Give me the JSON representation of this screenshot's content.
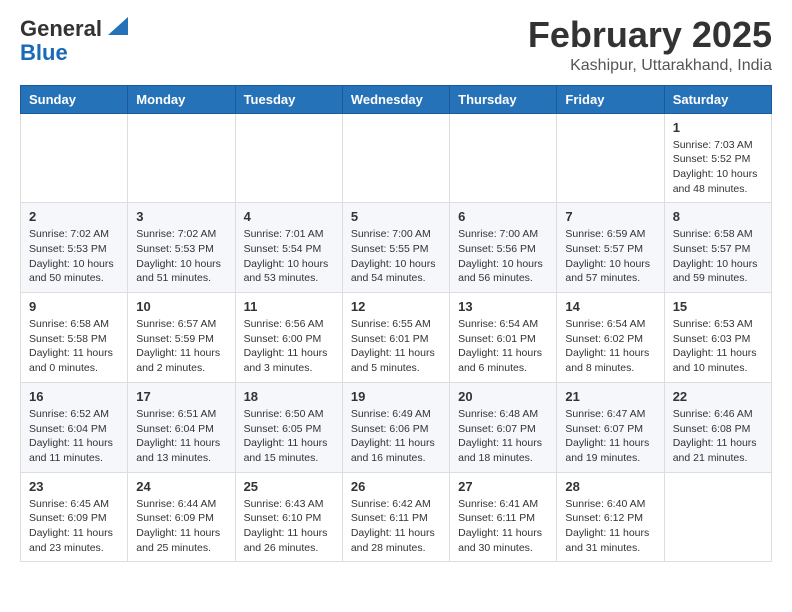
{
  "logo": {
    "general": "General",
    "blue": "Blue"
  },
  "header": {
    "month": "February 2025",
    "location": "Kashipur, Uttarakhand, India"
  },
  "days_of_week": [
    "Sunday",
    "Monday",
    "Tuesday",
    "Wednesday",
    "Thursday",
    "Friday",
    "Saturday"
  ],
  "weeks": [
    [
      {
        "day": "",
        "info": ""
      },
      {
        "day": "",
        "info": ""
      },
      {
        "day": "",
        "info": ""
      },
      {
        "day": "",
        "info": ""
      },
      {
        "day": "",
        "info": ""
      },
      {
        "day": "",
        "info": ""
      },
      {
        "day": "1",
        "info": "Sunrise: 7:03 AM\nSunset: 5:52 PM\nDaylight: 10 hours and 48 minutes."
      }
    ],
    [
      {
        "day": "2",
        "info": "Sunrise: 7:02 AM\nSunset: 5:53 PM\nDaylight: 10 hours and 50 minutes."
      },
      {
        "day": "3",
        "info": "Sunrise: 7:02 AM\nSunset: 5:53 PM\nDaylight: 10 hours and 51 minutes."
      },
      {
        "day": "4",
        "info": "Sunrise: 7:01 AM\nSunset: 5:54 PM\nDaylight: 10 hours and 53 minutes."
      },
      {
        "day": "5",
        "info": "Sunrise: 7:00 AM\nSunset: 5:55 PM\nDaylight: 10 hours and 54 minutes."
      },
      {
        "day": "6",
        "info": "Sunrise: 7:00 AM\nSunset: 5:56 PM\nDaylight: 10 hours and 56 minutes."
      },
      {
        "day": "7",
        "info": "Sunrise: 6:59 AM\nSunset: 5:57 PM\nDaylight: 10 hours and 57 minutes."
      },
      {
        "day": "8",
        "info": "Sunrise: 6:58 AM\nSunset: 5:57 PM\nDaylight: 10 hours and 59 minutes."
      }
    ],
    [
      {
        "day": "9",
        "info": "Sunrise: 6:58 AM\nSunset: 5:58 PM\nDaylight: 11 hours and 0 minutes."
      },
      {
        "day": "10",
        "info": "Sunrise: 6:57 AM\nSunset: 5:59 PM\nDaylight: 11 hours and 2 minutes."
      },
      {
        "day": "11",
        "info": "Sunrise: 6:56 AM\nSunset: 6:00 PM\nDaylight: 11 hours and 3 minutes."
      },
      {
        "day": "12",
        "info": "Sunrise: 6:55 AM\nSunset: 6:01 PM\nDaylight: 11 hours and 5 minutes."
      },
      {
        "day": "13",
        "info": "Sunrise: 6:54 AM\nSunset: 6:01 PM\nDaylight: 11 hours and 6 minutes."
      },
      {
        "day": "14",
        "info": "Sunrise: 6:54 AM\nSunset: 6:02 PM\nDaylight: 11 hours and 8 minutes."
      },
      {
        "day": "15",
        "info": "Sunrise: 6:53 AM\nSunset: 6:03 PM\nDaylight: 11 hours and 10 minutes."
      }
    ],
    [
      {
        "day": "16",
        "info": "Sunrise: 6:52 AM\nSunset: 6:04 PM\nDaylight: 11 hours and 11 minutes."
      },
      {
        "day": "17",
        "info": "Sunrise: 6:51 AM\nSunset: 6:04 PM\nDaylight: 11 hours and 13 minutes."
      },
      {
        "day": "18",
        "info": "Sunrise: 6:50 AM\nSunset: 6:05 PM\nDaylight: 11 hours and 15 minutes."
      },
      {
        "day": "19",
        "info": "Sunrise: 6:49 AM\nSunset: 6:06 PM\nDaylight: 11 hours and 16 minutes."
      },
      {
        "day": "20",
        "info": "Sunrise: 6:48 AM\nSunset: 6:07 PM\nDaylight: 11 hours and 18 minutes."
      },
      {
        "day": "21",
        "info": "Sunrise: 6:47 AM\nSunset: 6:07 PM\nDaylight: 11 hours and 19 minutes."
      },
      {
        "day": "22",
        "info": "Sunrise: 6:46 AM\nSunset: 6:08 PM\nDaylight: 11 hours and 21 minutes."
      }
    ],
    [
      {
        "day": "23",
        "info": "Sunrise: 6:45 AM\nSunset: 6:09 PM\nDaylight: 11 hours and 23 minutes."
      },
      {
        "day": "24",
        "info": "Sunrise: 6:44 AM\nSunset: 6:09 PM\nDaylight: 11 hours and 25 minutes."
      },
      {
        "day": "25",
        "info": "Sunrise: 6:43 AM\nSunset: 6:10 PM\nDaylight: 11 hours and 26 minutes."
      },
      {
        "day": "26",
        "info": "Sunrise: 6:42 AM\nSunset: 6:11 PM\nDaylight: 11 hours and 28 minutes."
      },
      {
        "day": "27",
        "info": "Sunrise: 6:41 AM\nSunset: 6:11 PM\nDaylight: 11 hours and 30 minutes."
      },
      {
        "day": "28",
        "info": "Sunrise: 6:40 AM\nSunset: 6:12 PM\nDaylight: 11 hours and 31 minutes."
      },
      {
        "day": "",
        "info": ""
      }
    ]
  ]
}
